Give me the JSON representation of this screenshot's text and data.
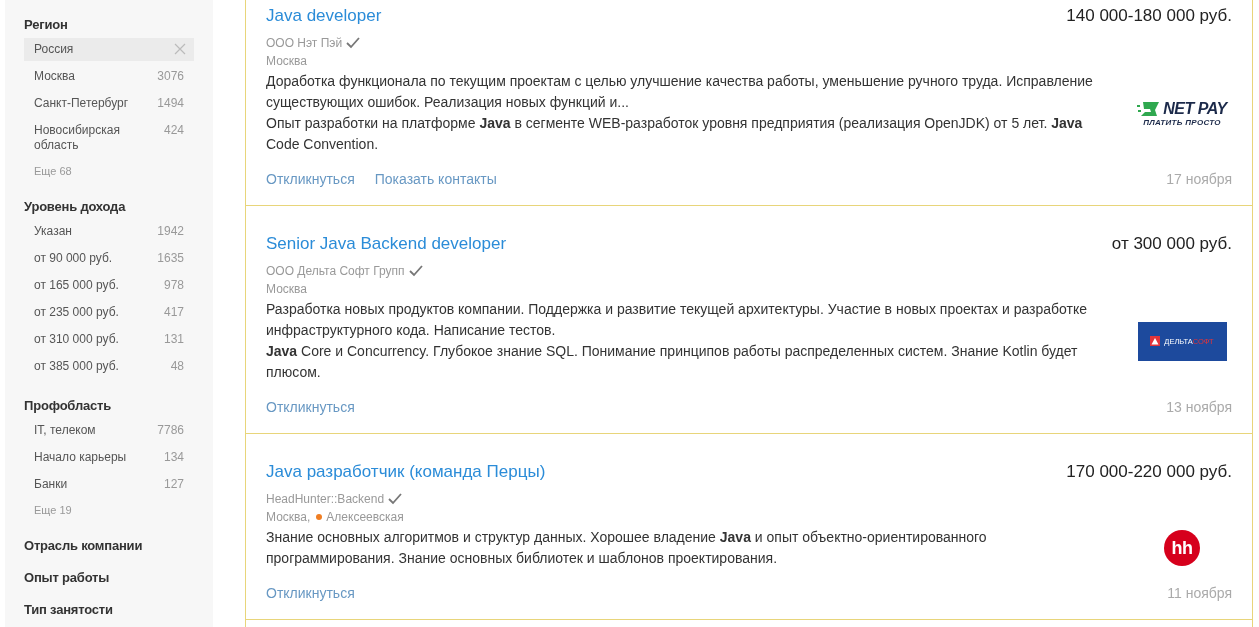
{
  "sidebar": {
    "groups": [
      {
        "title": "Регион",
        "items": [
          {
            "label": "Россия",
            "selected": true
          },
          {
            "label": "Москва",
            "count": "3076",
            "selected": false
          },
          {
            "label": "Санкт-Петербург",
            "count": "1494",
            "selected": false
          },
          {
            "label": "Новосибирская область",
            "count": "424",
            "selected": false
          }
        ],
        "more": "Еще 68"
      },
      {
        "title": "Уровень дохода",
        "items": [
          {
            "label": "Указан",
            "count": "1942",
            "selected": false
          },
          {
            "label": "от 90 000 руб.",
            "count": "1635",
            "selected": false
          },
          {
            "label": "от 165 000 руб.",
            "count": "978",
            "selected": false
          },
          {
            "label": "от 235 000 руб.",
            "count": "417",
            "selected": false
          },
          {
            "label": "от 310 000 руб.",
            "count": "131",
            "selected": false
          },
          {
            "label": "от 385 000 руб.",
            "count": "48",
            "selected": false
          }
        ]
      },
      {
        "title": "Профобласть",
        "items": [
          {
            "label": "IT, телеком",
            "count": "7786",
            "selected": false
          },
          {
            "label": "Начало карьеры",
            "count": "134",
            "selected": false
          },
          {
            "label": "Банки",
            "count": "127",
            "selected": false
          }
        ],
        "more": "Еще 19"
      },
      {
        "title": "Отрасль компании"
      },
      {
        "title": "Опыт работы"
      },
      {
        "title": "Тип занятости"
      }
    ]
  },
  "vacancies": [
    {
      "title": "Java developer",
      "salary": "140 000-180 000 руб.",
      "company": "ООО Нэт Пэй",
      "verified": true,
      "location": "Москва",
      "paragraphs": [
        "Доработка функционала по текущим проектам с целью улучшение качества работы, уменьшение ручного труда. Исправление существующих ошибок. Реализация новых функций и...",
        "Опыт разработки на платформе **Java** в сегменте WEB-разработок уровня предприятия (реализация OpenJDK) от 5 лет. **Java** Code Convention."
      ],
      "logo": {
        "kind": "netpay",
        "text": "NET PAY",
        "tagline": "ПЛАТИТЬ ПРОСТО"
      },
      "actions": [
        "Откликнуться",
        "Показать контакты"
      ],
      "date": "17 ноября"
    },
    {
      "title": "Senior Java Backend developer",
      "salary": "от 300 000 руб.",
      "company": "ООО Дельта Софт Групп",
      "verified": true,
      "location": "Москва",
      "paragraphs": [
        "Разработка новых продуктов компании. Поддержка и развитие текущей архитектуры. Участие в новых проектах и разработке инфраструктурного кода. Написание тестов.",
        "**Java** Core и Concurrency. Глубокое знание SQL. Понимание принципов работы распределенных систем. Знание Kotlin будет плюсом."
      ],
      "logo": {
        "kind": "deltasoft",
        "text": "ДЕЛЬТА",
        "text2": "СОФТ"
      },
      "actions": [
        "Откликнуться"
      ],
      "date": "13 ноября"
    },
    {
      "title": "Java разработчик (команда Перцы)",
      "salary": "170 000-220 000 руб.",
      "company": "HeadHunter::Backend",
      "verified": true,
      "location": "Москва,",
      "metro": {
        "name": "Алексеевская",
        "color": "#f07e23"
      },
      "paragraphs": [
        "Знание основных алгоритмов и структур данных. Хорошее владение **Java** и опыт объектно-ориентированного программирования. Знание основных библиотек и шаблонов проектирования."
      ],
      "logo": {
        "kind": "hh",
        "text": "hh"
      },
      "actions": [
        "Откликнуться"
      ],
      "date": "11 ноября"
    }
  ]
}
